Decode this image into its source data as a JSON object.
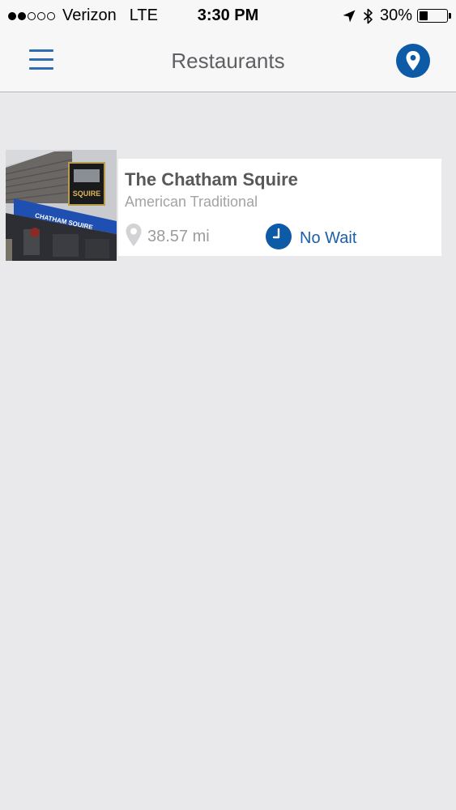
{
  "status_bar": {
    "carrier": "Verizon",
    "network": "LTE",
    "time": "3:30 PM",
    "battery": "30%",
    "battery_fraction": 0.3,
    "signal_bars_filled": 2,
    "signal_bars_total": 5,
    "icons": [
      "location-arrow-icon",
      "bluetooth-icon",
      "battery-icon"
    ]
  },
  "nav": {
    "title": "Restaurants",
    "left_icon": "hamburger-menu-icon",
    "right_icon": "map-pin-icon"
  },
  "restaurants": [
    {
      "name": "The Chatham Squire",
      "cuisine": "American Traditional",
      "distance": "38.57 mi",
      "wait": "No Wait",
      "distance_icon": "location-pin-icon",
      "wait_icon": "clock-icon",
      "image_sign_text": "SQUIRE",
      "image_awning_text": "CHATHAM SQUIRE"
    }
  ],
  "colors": {
    "accent": "#0d5aa7",
    "wait_text": "#1c5fa8",
    "background": "#e9e9eb",
    "header_bg": "#f7f7f8",
    "title_text": "#5f6063"
  }
}
